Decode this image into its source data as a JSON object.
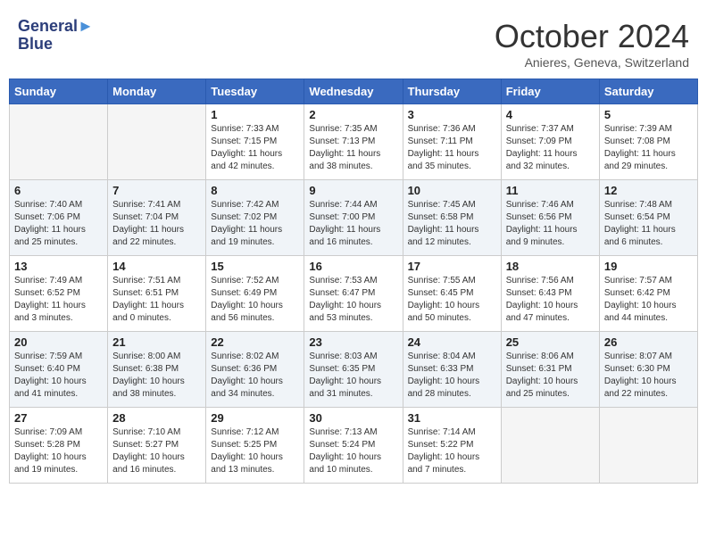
{
  "header": {
    "logo_line1": "General",
    "logo_line2": "Blue",
    "month_title": "October 2024",
    "subtitle": "Anieres, Geneva, Switzerland"
  },
  "days_of_week": [
    "Sunday",
    "Monday",
    "Tuesday",
    "Wednesday",
    "Thursday",
    "Friday",
    "Saturday"
  ],
  "weeks": [
    [
      {
        "day": "",
        "sunrise": "",
        "sunset": "",
        "daylight": ""
      },
      {
        "day": "",
        "sunrise": "",
        "sunset": "",
        "daylight": ""
      },
      {
        "day": "1",
        "sunrise": "Sunrise: 7:33 AM",
        "sunset": "Sunset: 7:15 PM",
        "daylight": "Daylight: 11 hours and 42 minutes."
      },
      {
        "day": "2",
        "sunrise": "Sunrise: 7:35 AM",
        "sunset": "Sunset: 7:13 PM",
        "daylight": "Daylight: 11 hours and 38 minutes."
      },
      {
        "day": "3",
        "sunrise": "Sunrise: 7:36 AM",
        "sunset": "Sunset: 7:11 PM",
        "daylight": "Daylight: 11 hours and 35 minutes."
      },
      {
        "day": "4",
        "sunrise": "Sunrise: 7:37 AM",
        "sunset": "Sunset: 7:09 PM",
        "daylight": "Daylight: 11 hours and 32 minutes."
      },
      {
        "day": "5",
        "sunrise": "Sunrise: 7:39 AM",
        "sunset": "Sunset: 7:08 PM",
        "daylight": "Daylight: 11 hours and 29 minutes."
      }
    ],
    [
      {
        "day": "6",
        "sunrise": "Sunrise: 7:40 AM",
        "sunset": "Sunset: 7:06 PM",
        "daylight": "Daylight: 11 hours and 25 minutes."
      },
      {
        "day": "7",
        "sunrise": "Sunrise: 7:41 AM",
        "sunset": "Sunset: 7:04 PM",
        "daylight": "Daylight: 11 hours and 22 minutes."
      },
      {
        "day": "8",
        "sunrise": "Sunrise: 7:42 AM",
        "sunset": "Sunset: 7:02 PM",
        "daylight": "Daylight: 11 hours and 19 minutes."
      },
      {
        "day": "9",
        "sunrise": "Sunrise: 7:44 AM",
        "sunset": "Sunset: 7:00 PM",
        "daylight": "Daylight: 11 hours and 16 minutes."
      },
      {
        "day": "10",
        "sunrise": "Sunrise: 7:45 AM",
        "sunset": "Sunset: 6:58 PM",
        "daylight": "Daylight: 11 hours and 12 minutes."
      },
      {
        "day": "11",
        "sunrise": "Sunrise: 7:46 AM",
        "sunset": "Sunset: 6:56 PM",
        "daylight": "Daylight: 11 hours and 9 minutes."
      },
      {
        "day": "12",
        "sunrise": "Sunrise: 7:48 AM",
        "sunset": "Sunset: 6:54 PM",
        "daylight": "Daylight: 11 hours and 6 minutes."
      }
    ],
    [
      {
        "day": "13",
        "sunrise": "Sunrise: 7:49 AM",
        "sunset": "Sunset: 6:52 PM",
        "daylight": "Daylight: 11 hours and 3 minutes."
      },
      {
        "day": "14",
        "sunrise": "Sunrise: 7:51 AM",
        "sunset": "Sunset: 6:51 PM",
        "daylight": "Daylight: 11 hours and 0 minutes."
      },
      {
        "day": "15",
        "sunrise": "Sunrise: 7:52 AM",
        "sunset": "Sunset: 6:49 PM",
        "daylight": "Daylight: 10 hours and 56 minutes."
      },
      {
        "day": "16",
        "sunrise": "Sunrise: 7:53 AM",
        "sunset": "Sunset: 6:47 PM",
        "daylight": "Daylight: 10 hours and 53 minutes."
      },
      {
        "day": "17",
        "sunrise": "Sunrise: 7:55 AM",
        "sunset": "Sunset: 6:45 PM",
        "daylight": "Daylight: 10 hours and 50 minutes."
      },
      {
        "day": "18",
        "sunrise": "Sunrise: 7:56 AM",
        "sunset": "Sunset: 6:43 PM",
        "daylight": "Daylight: 10 hours and 47 minutes."
      },
      {
        "day": "19",
        "sunrise": "Sunrise: 7:57 AM",
        "sunset": "Sunset: 6:42 PM",
        "daylight": "Daylight: 10 hours and 44 minutes."
      }
    ],
    [
      {
        "day": "20",
        "sunrise": "Sunrise: 7:59 AM",
        "sunset": "Sunset: 6:40 PM",
        "daylight": "Daylight: 10 hours and 41 minutes."
      },
      {
        "day": "21",
        "sunrise": "Sunrise: 8:00 AM",
        "sunset": "Sunset: 6:38 PM",
        "daylight": "Daylight: 10 hours and 38 minutes."
      },
      {
        "day": "22",
        "sunrise": "Sunrise: 8:02 AM",
        "sunset": "Sunset: 6:36 PM",
        "daylight": "Daylight: 10 hours and 34 minutes."
      },
      {
        "day": "23",
        "sunrise": "Sunrise: 8:03 AM",
        "sunset": "Sunset: 6:35 PM",
        "daylight": "Daylight: 10 hours and 31 minutes."
      },
      {
        "day": "24",
        "sunrise": "Sunrise: 8:04 AM",
        "sunset": "Sunset: 6:33 PM",
        "daylight": "Daylight: 10 hours and 28 minutes."
      },
      {
        "day": "25",
        "sunrise": "Sunrise: 8:06 AM",
        "sunset": "Sunset: 6:31 PM",
        "daylight": "Daylight: 10 hours and 25 minutes."
      },
      {
        "day": "26",
        "sunrise": "Sunrise: 8:07 AM",
        "sunset": "Sunset: 6:30 PM",
        "daylight": "Daylight: 10 hours and 22 minutes."
      }
    ],
    [
      {
        "day": "27",
        "sunrise": "Sunrise: 7:09 AM",
        "sunset": "Sunset: 5:28 PM",
        "daylight": "Daylight: 10 hours and 19 minutes."
      },
      {
        "day": "28",
        "sunrise": "Sunrise: 7:10 AM",
        "sunset": "Sunset: 5:27 PM",
        "daylight": "Daylight: 10 hours and 16 minutes."
      },
      {
        "day": "29",
        "sunrise": "Sunrise: 7:12 AM",
        "sunset": "Sunset: 5:25 PM",
        "daylight": "Daylight: 10 hours and 13 minutes."
      },
      {
        "day": "30",
        "sunrise": "Sunrise: 7:13 AM",
        "sunset": "Sunset: 5:24 PM",
        "daylight": "Daylight: 10 hours and 10 minutes."
      },
      {
        "day": "31",
        "sunrise": "Sunrise: 7:14 AM",
        "sunset": "Sunset: 5:22 PM",
        "daylight": "Daylight: 10 hours and 7 minutes."
      },
      {
        "day": "",
        "sunrise": "",
        "sunset": "",
        "daylight": ""
      },
      {
        "day": "",
        "sunrise": "",
        "sunset": "",
        "daylight": ""
      }
    ]
  ]
}
